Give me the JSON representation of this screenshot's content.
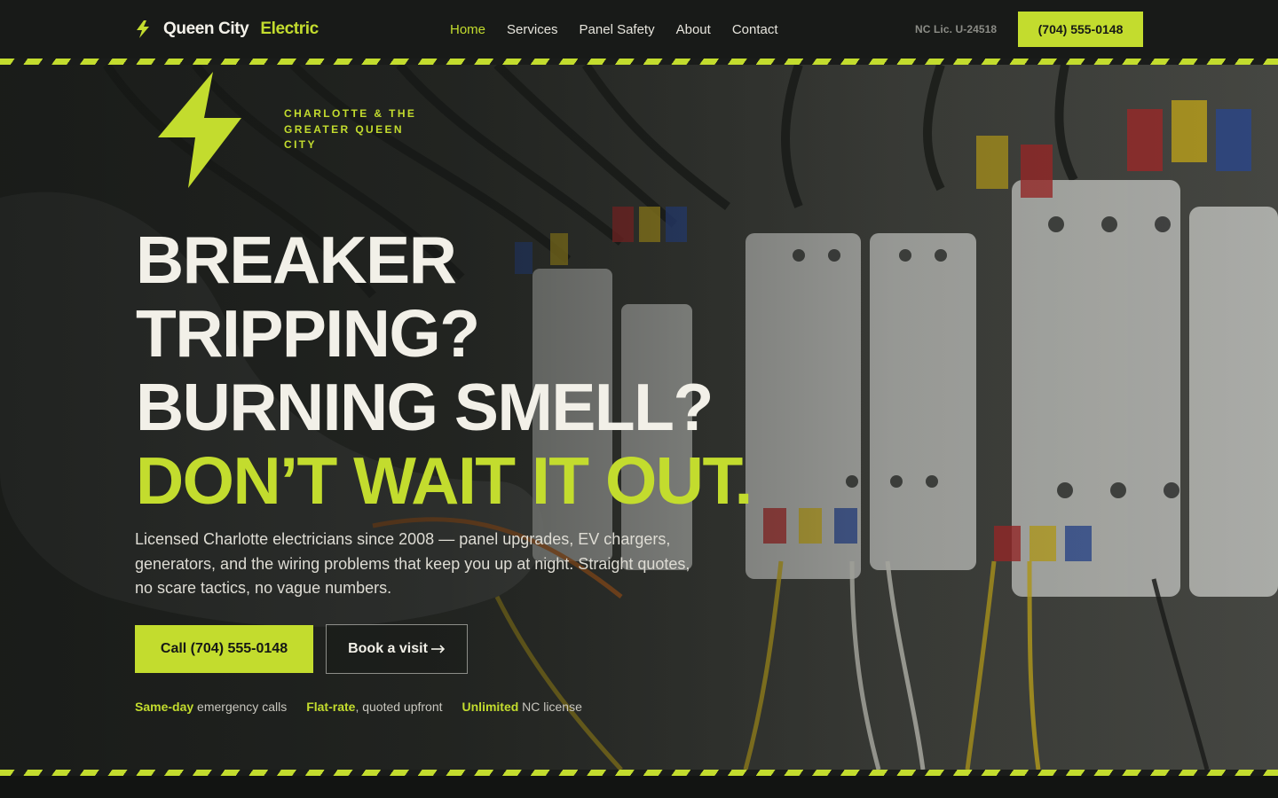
{
  "brand": {
    "name_primary": "Queen City",
    "name_accent": "Electric",
    "bolt_icon": "lightning-bolt-icon",
    "accent_color": "#c3dc2e"
  },
  "nav": {
    "items": [
      {
        "label": "Home",
        "active": true
      },
      {
        "label": "Services",
        "active": false
      },
      {
        "label": "Panel Safety",
        "active": false
      },
      {
        "label": "About",
        "active": false
      },
      {
        "label": "Contact",
        "active": false
      }
    ]
  },
  "header": {
    "license": "NC Lic. U-24518",
    "phone_button": "(704) 555-0148"
  },
  "hero": {
    "region_tag": "Charlotte & the greater Queen City",
    "headline": [
      "BREAKER",
      "TRIPPING?",
      "BURNING SMELL?",
      "DON’T WAIT IT OUT."
    ],
    "lead": "Licensed Charlotte electricians since 2008 — panel upgrades, EV chargers, generators, and the wiring problems that keep you up at night. Straight quotes, no scare tactics, no vague numbers.",
    "primary_cta": "Call (704) 555-0148",
    "secondary_cta": "Book a visit",
    "secondary_cta_icon": "arrow-right-icon",
    "trust": [
      {
        "highlight": "Same-day",
        "text": " emergency calls"
      },
      {
        "highlight": "Flat-rate",
        "text": ", quoted upfront"
      },
      {
        "highlight": "Unlimited",
        "text": " NC license"
      }
    ]
  }
}
